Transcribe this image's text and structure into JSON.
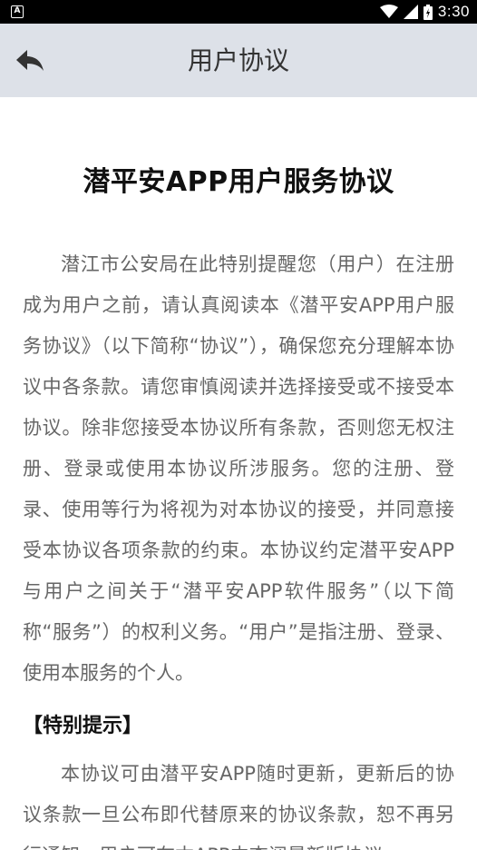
{
  "status_bar": {
    "app_icon_text": "A",
    "time": "3:30"
  },
  "header": {
    "title": "用户协议"
  },
  "document": {
    "title": "潜平安APP用户服务协议",
    "intro_paragraph": "潜江市公安局在此特别提醒您（用户）在注册成为用户之前，请认真阅读本《潜平安APP用户服务协议》（以下简称“协议”），确保您充分理解本协议中各条款。请您审慎阅读并选择接受或不接受本协议。除非您接受本协议所有条款，否则您无权注册、登录或使用本协议所涉服务。您的注册、登录、使用等行为将视为对本协议的接受，并同意接受本协议各项条款的约束。本协议约定潜平安APP与用户之间关于“潜平安APP软件服务”（以下简称“服务”）的权利义务。“用户”是指注册、登录、使用本服务的个人。",
    "section_heading": "【特别提示】",
    "section_paragraph": "本协议可由潜平安APP随时更新，更新后的协议条款一旦公布即代替原来的协议条款，恕不再另行通知，用户可在本APP中查阅最新版协议"
  }
}
